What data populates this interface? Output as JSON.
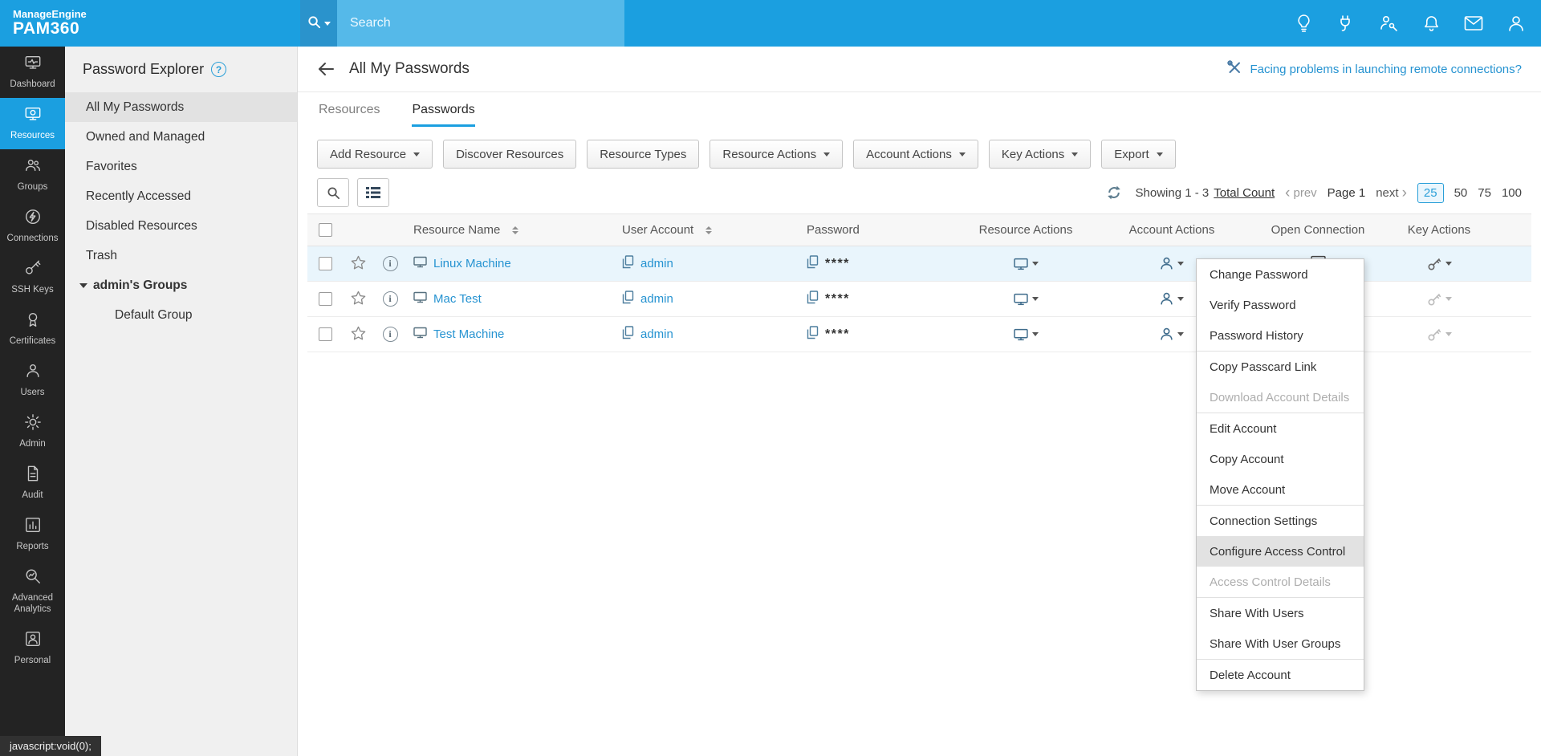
{
  "topbar": {
    "logo_line1": "ManageEngine",
    "logo_line2": "PAM360",
    "search_placeholder": "Search"
  },
  "left_nav": {
    "items": [
      {
        "label": "Dashboard",
        "active": false
      },
      {
        "label": "Resources",
        "active": true
      },
      {
        "label": "Groups",
        "active": false
      },
      {
        "label": "Connections",
        "active": false
      },
      {
        "label": "SSH Keys",
        "active": false
      },
      {
        "label": "Certificates",
        "active": false
      },
      {
        "label": "Users",
        "active": false
      },
      {
        "label": "Admin",
        "active": false
      },
      {
        "label": "Audit",
        "active": false
      },
      {
        "label": "Reports",
        "active": false
      },
      {
        "label": "Advanced Analytics",
        "active": false
      },
      {
        "label": "Personal",
        "active": false
      }
    ]
  },
  "explorer": {
    "title": "Password Explorer",
    "items": [
      {
        "label": "All My Passwords",
        "selected": true
      },
      {
        "label": "Owned and Managed",
        "selected": false
      },
      {
        "label": "Favorites",
        "selected": false
      },
      {
        "label": "Recently Accessed",
        "selected": false
      },
      {
        "label": "Disabled Resources",
        "selected": false
      },
      {
        "label": "Trash",
        "selected": false
      }
    ],
    "group_header": "admin's Groups",
    "group_items": [
      {
        "label": "Default Group"
      }
    ]
  },
  "main": {
    "title": "All My Passwords",
    "help_link": "Facing problems in launching remote connections?",
    "tabs": [
      {
        "label": "Resources",
        "active": false
      },
      {
        "label": "Passwords",
        "active": true
      }
    ],
    "toolbar": [
      {
        "label": "Add Resource",
        "dropdown": true
      },
      {
        "label": "Discover Resources",
        "dropdown": false
      },
      {
        "label": "Resource Types",
        "dropdown": false
      },
      {
        "label": "Resource Actions",
        "dropdown": true
      },
      {
        "label": "Account Actions",
        "dropdown": true
      },
      {
        "label": "Key Actions",
        "dropdown": true
      },
      {
        "label": "Export",
        "dropdown": true
      }
    ],
    "pagination": {
      "showing": "Showing 1 - 3",
      "total_link": "Total Count",
      "prev_label": "prev",
      "page_label": "Page 1",
      "next_label": "next",
      "page_sizes": [
        "25",
        "50",
        "75",
        "100"
      ],
      "selected_size": "25"
    },
    "table": {
      "columns": [
        "Resource Name",
        "User Account",
        "Password",
        "Resource Actions",
        "Account Actions",
        "Open Connection",
        "Key Actions"
      ],
      "rows": [
        {
          "resource_name": "Linux Machine",
          "user_account": "admin",
          "password_mask": "****",
          "selected": true
        },
        {
          "resource_name": "Mac Test",
          "user_account": "admin",
          "password_mask": "****",
          "selected": false
        },
        {
          "resource_name": "Test Machine",
          "user_account": "admin",
          "password_mask": "****",
          "selected": false
        }
      ]
    }
  },
  "context_menu": {
    "items": [
      {
        "label": "Change Password",
        "disabled": false,
        "highlighted": false
      },
      {
        "label": "Verify Password",
        "disabled": false,
        "highlighted": false
      },
      {
        "label": "Password History",
        "disabled": false,
        "highlighted": false
      },
      {
        "label": "Copy Passcard Link",
        "disabled": false,
        "highlighted": false
      },
      {
        "label": "Download Account Details",
        "disabled": true,
        "highlighted": false
      },
      {
        "label": "Edit Account",
        "disabled": false,
        "highlighted": false
      },
      {
        "label": "Copy Account",
        "disabled": false,
        "highlighted": false
      },
      {
        "label": "Move Account",
        "disabled": false,
        "highlighted": false
      },
      {
        "label": "Connection Settings",
        "disabled": false,
        "highlighted": false
      },
      {
        "label": "Configure Access Control",
        "disabled": false,
        "highlighted": true
      },
      {
        "label": "Access Control Details",
        "disabled": true,
        "highlighted": false
      },
      {
        "label": "Share With Users",
        "disabled": false,
        "highlighted": false
      },
      {
        "label": "Share With User Groups",
        "disabled": false,
        "highlighted": false
      },
      {
        "label": "Delete Account",
        "disabled": false,
        "highlighted": false
      }
    ]
  },
  "statusbar": {
    "text": "javascript:void(0);"
  },
  "colors": {
    "accent": "#1b9fe0",
    "link": "#2693d1",
    "selected_row": "#e9f5fc",
    "sidebar": "#232323"
  },
  "icons": {
    "search": "magnifier",
    "refresh": "circular-arrows",
    "wrench": "crossed-tools",
    "favorite": "outline-star",
    "info": "circled-i",
    "copy": "duplicate-pages",
    "resource": "monitor",
    "account_actions": "person",
    "key_actions": "key",
    "open_connection": "monitor-play"
  }
}
